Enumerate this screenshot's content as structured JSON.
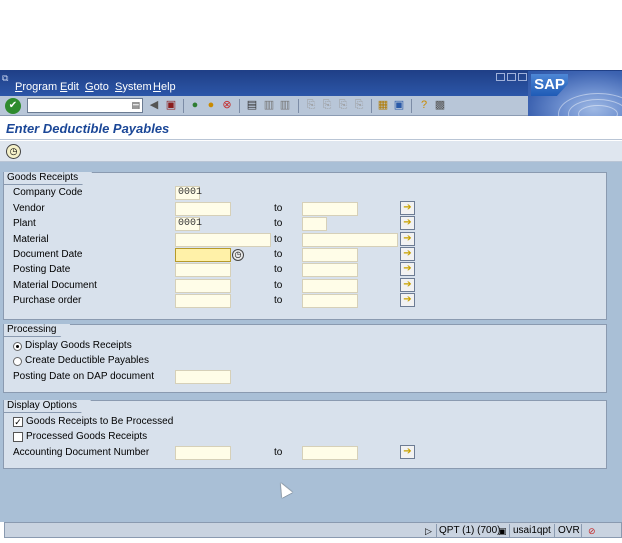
{
  "menubar": {
    "items": [
      "Program",
      "Edit",
      "Goto",
      "System",
      "Help"
    ],
    "logo": "SAP"
  },
  "toolbar": {
    "ok_icon": "check-icon",
    "command_value": "",
    "icons": [
      "back-arrow-icon",
      "save-icon",
      "back-icon",
      "exit-icon",
      "cancel-icon",
      "print-icon",
      "find-icon",
      "find-next-icon",
      "first-page-icon",
      "previous-page-icon",
      "next-page-icon",
      "last-page-icon",
      "new-session-icon",
      "shortcut-icon",
      "help-icon",
      "customize-layout-icon"
    ]
  },
  "title": "Enter Deductible Payables",
  "app_toolbar": {
    "execute_icon": "execute-icon"
  },
  "goods_receipts": {
    "legend": "Goods Receipts",
    "to_label": "to",
    "rows": [
      {
        "label": "Company Code",
        "from": "0001",
        "to": null
      },
      {
        "label": "Vendor",
        "from": "",
        "to": ""
      },
      {
        "label": "Plant",
        "from": "0001",
        "to": ""
      },
      {
        "label": "Material",
        "from": "",
        "to": ""
      },
      {
        "label": "Document Date",
        "from": "",
        "to": ""
      },
      {
        "label": "Posting Date",
        "from": "",
        "to": ""
      },
      {
        "label": "Material Document",
        "from": "",
        "to": ""
      },
      {
        "label": "Purchase order",
        "from": "",
        "to": ""
      }
    ]
  },
  "processing": {
    "legend": "Processing",
    "options": [
      {
        "label": "Display Goods Receipts",
        "selected": true
      },
      {
        "label": "Create Deductible Payables",
        "selected": false
      }
    ],
    "posting_date_label": "Posting Date on DAP document",
    "posting_date_value": ""
  },
  "display_options": {
    "legend": "Display Options",
    "checkboxes": [
      {
        "label": "Goods Receipts to Be Processed",
        "checked": true
      },
      {
        "label": "Processed Goods Receipts",
        "checked": false
      }
    ],
    "acct_doc_label": "Accounting Document Number",
    "acct_doc_from": "",
    "acct_doc_to": "",
    "to_label": "to"
  },
  "statusbar": {
    "system": "QPT (1) (700)",
    "server": "usai1qpt",
    "mode": "OVR"
  },
  "colors": {
    "menubar": "#2c56a8",
    "toolbar": "#b8c6d8",
    "workarea": "#a9bfd6",
    "group": "#d8e1ec",
    "title": "#1b4797"
  }
}
